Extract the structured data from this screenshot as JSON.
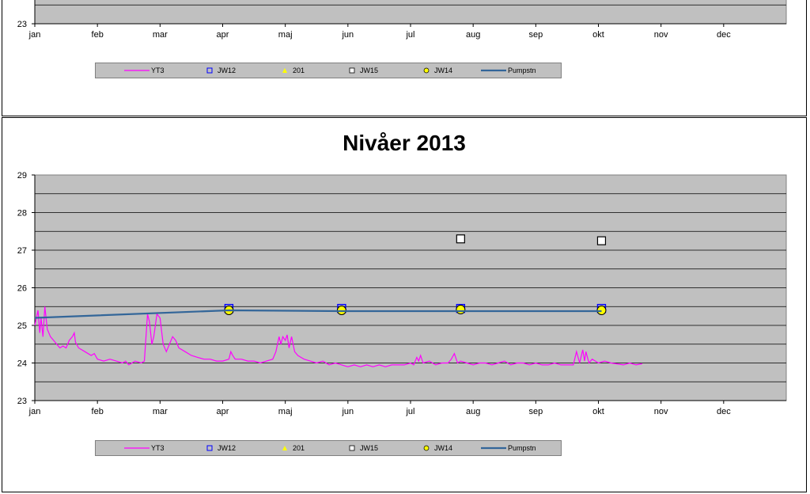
{
  "colors": {
    "plot_bg": "#c0c0c0",
    "grid": "#000000",
    "YT3": "#ff00ff",
    "JW12": "#0000ff",
    "201": "#ffff00",
    "JW15": "#ffffff",
    "JW14": "#ffff00",
    "Pumpstn": "#336699"
  },
  "legend": {
    "items": [
      {
        "key": "YT3",
        "label": "YT3",
        "icon": "magenta-line-icon"
      },
      {
        "key": "JW12",
        "label": "JW12",
        "icon": "blue-hollow-square-icon"
      },
      {
        "key": "201",
        "label": "201",
        "icon": "yellow-triangle-icon"
      },
      {
        "key": "JW15",
        "label": "JW15",
        "icon": "white-square-icon"
      },
      {
        "key": "JW14",
        "label": "JW14",
        "icon": "yellow-circle-icon"
      },
      {
        "key": "Pumpstn",
        "label": "Pumpstn",
        "icon": "blue-line-icon"
      }
    ]
  },
  "chart_data": [
    {
      "type": "line",
      "title": "",
      "xlabel": "",
      "ylabel": "",
      "x_categories": [
        "jan",
        "feb",
        "mar",
        "apr",
        "maj",
        "jun",
        "jul",
        "aug",
        "sep",
        "okt",
        "nov",
        "dec"
      ],
      "xlim": [
        0,
        12
      ],
      "visible_yticks": [
        "23"
      ],
      "grid": true,
      "legend_position": "bottom",
      "series": []
    },
    {
      "type": "line",
      "title": "Nivåer 2013",
      "xlabel": "",
      "ylabel": "",
      "x_categories": [
        "jan",
        "feb",
        "mar",
        "apr",
        "maj",
        "jun",
        "jul",
        "aug",
        "sep",
        "okt",
        "nov",
        "dec"
      ],
      "xlim": [
        0,
        12
      ],
      "ylim": [
        23,
        29
      ],
      "yticks": [
        "23",
        "24",
        "25",
        "26",
        "27",
        "28",
        "29"
      ],
      "grid": true,
      "legend_position": "bottom",
      "series": [
        {
          "name": "YT3",
          "kind": "line",
          "points": [
            [
              0.0,
              25.0
            ],
            [
              0.05,
              25.4
            ],
            [
              0.08,
              24.8
            ],
            [
              0.1,
              25.2
            ],
            [
              0.13,
              24.7
            ],
            [
              0.16,
              25.5
            ],
            [
              0.2,
              24.9
            ],
            [
              0.25,
              24.7
            ],
            [
              0.3,
              24.6
            ],
            [
              0.35,
              24.5
            ],
            [
              0.4,
              24.4
            ],
            [
              0.45,
              24.45
            ],
            [
              0.5,
              24.4
            ],
            [
              0.55,
              24.6
            ],
            [
              0.6,
              24.7
            ],
            [
              0.63,
              24.8
            ],
            [
              0.65,
              24.55
            ],
            [
              0.7,
              24.4
            ],
            [
              0.8,
              24.3
            ],
            [
              0.9,
              24.2
            ],
            [
              0.95,
              24.25
            ],
            [
              1.0,
              24.1
            ],
            [
              1.1,
              24.05
            ],
            [
              1.2,
              24.1
            ],
            [
              1.3,
              24.05
            ],
            [
              1.4,
              24.0
            ],
            [
              1.45,
              24.05
            ],
            [
              1.5,
              23.95
            ],
            [
              1.6,
              24.05
            ],
            [
              1.7,
              24.0
            ],
            [
              1.75,
              24.05
            ],
            [
              1.8,
              25.3
            ],
            [
              1.83,
              25.1
            ],
            [
              1.87,
              24.5
            ],
            [
              1.9,
              24.7
            ],
            [
              1.95,
              25.3
            ],
            [
              2.0,
              25.2
            ],
            [
              2.05,
              24.5
            ],
            [
              2.1,
              24.3
            ],
            [
              2.15,
              24.5
            ],
            [
              2.2,
              24.7
            ],
            [
              2.25,
              24.6
            ],
            [
              2.3,
              24.4
            ],
            [
              2.4,
              24.3
            ],
            [
              2.5,
              24.2
            ],
            [
              2.6,
              24.15
            ],
            [
              2.7,
              24.1
            ],
            [
              2.8,
              24.1
            ],
            [
              2.9,
              24.05
            ],
            [
              3.0,
              24.05
            ],
            [
              3.1,
              24.1
            ],
            [
              3.13,
              24.3
            ],
            [
              3.16,
              24.2
            ],
            [
              3.2,
              24.1
            ],
            [
              3.3,
              24.1
            ],
            [
              3.4,
              24.05
            ],
            [
              3.5,
              24.05
            ],
            [
              3.6,
              24.0
            ],
            [
              3.7,
              24.05
            ],
            [
              3.8,
              24.1
            ],
            [
              3.85,
              24.3
            ],
            [
              3.9,
              24.7
            ],
            [
              3.93,
              24.5
            ],
            [
              3.96,
              24.7
            ],
            [
              4.0,
              24.6
            ],
            [
              4.03,
              24.75
            ],
            [
              4.06,
              24.4
            ],
            [
              4.1,
              24.7
            ],
            [
              4.15,
              24.3
            ],
            [
              4.2,
              24.2
            ],
            [
              4.3,
              24.1
            ],
            [
              4.4,
              24.05
            ],
            [
              4.5,
              24.0
            ],
            [
              4.6,
              24.05
            ],
            [
              4.7,
              23.95
            ],
            [
              4.8,
              24.0
            ],
            [
              4.9,
              23.95
            ],
            [
              5.0,
              23.9
            ],
            [
              5.1,
              23.95
            ],
            [
              5.2,
              23.9
            ],
            [
              5.3,
              23.95
            ],
            [
              5.4,
              23.9
            ],
            [
              5.5,
              23.95
            ],
            [
              5.6,
              23.9
            ],
            [
              5.7,
              23.95
            ],
            [
              5.8,
              23.95
            ],
            [
              5.9,
              23.95
            ],
            [
              6.0,
              24.0
            ],
            [
              6.05,
              23.95
            ],
            [
              6.1,
              24.15
            ],
            [
              6.13,
              24.05
            ],
            [
              6.16,
              24.2
            ],
            [
              6.2,
              24.0
            ],
            [
              6.3,
              24.05
            ],
            [
              6.4,
              23.95
            ],
            [
              6.5,
              24.0
            ],
            [
              6.6,
              24.0
            ],
            [
              6.65,
              24.1
            ],
            [
              6.7,
              24.25
            ],
            [
              6.75,
              24.0
            ],
            [
              6.8,
              24.05
            ],
            [
              6.9,
              24.0
            ],
            [
              7.0,
              23.95
            ],
            [
              7.1,
              24.0
            ],
            [
              7.2,
              24.0
            ],
            [
              7.3,
              23.95
            ],
            [
              7.4,
              24.0
            ],
            [
              7.5,
              24.05
            ],
            [
              7.6,
              23.95
            ],
            [
              7.7,
              24.0
            ],
            [
              7.8,
              24.0
            ],
            [
              7.9,
              23.95
            ],
            [
              8.0,
              24.0
            ],
            [
              8.1,
              23.95
            ],
            [
              8.2,
              23.95
            ],
            [
              8.3,
              24.0
            ],
            [
              8.4,
              23.95
            ],
            [
              8.5,
              23.95
            ],
            [
              8.6,
              23.95
            ],
            [
              8.65,
              24.3
            ],
            [
              8.7,
              24.0
            ],
            [
              8.75,
              24.35
            ],
            [
              8.78,
              24.05
            ],
            [
              8.8,
              24.3
            ],
            [
              8.85,
              24.0
            ],
            [
              8.9,
              24.1
            ],
            [
              9.0,
              24.0
            ],
            [
              9.1,
              24.05
            ],
            [
              9.2,
              24.0
            ],
            [
              9.4,
              23.95
            ],
            [
              9.5,
              24.0
            ],
            [
              9.6,
              23.95
            ],
            [
              9.7,
              23.98
            ]
          ]
        },
        {
          "name": "JW12",
          "kind": "marker-square-hollow",
          "points": [
            [
              3.1,
              25.45
            ],
            [
              4.9,
              25.45
            ],
            [
              6.8,
              25.45
            ],
            [
              9.05,
              25.45
            ]
          ]
        },
        {
          "name": "201",
          "kind": "marker-triangle",
          "points": []
        },
        {
          "name": "JW15",
          "kind": "marker-square-white",
          "points": [
            [
              6.8,
              27.3
            ],
            [
              9.05,
              27.25
            ]
          ]
        },
        {
          "name": "JW14",
          "kind": "marker-circle",
          "points": [
            [
              3.1,
              25.4
            ],
            [
              4.9,
              25.4
            ],
            [
              6.8,
              25.42
            ],
            [
              9.05,
              25.4
            ]
          ]
        },
        {
          "name": "Pumpstn",
          "kind": "line",
          "points": [
            [
              0.0,
              25.2
            ],
            [
              3.1,
              25.4
            ],
            [
              4.9,
              25.38
            ],
            [
              6.8,
              25.38
            ],
            [
              9.05,
              25.38
            ]
          ]
        }
      ]
    }
  ]
}
